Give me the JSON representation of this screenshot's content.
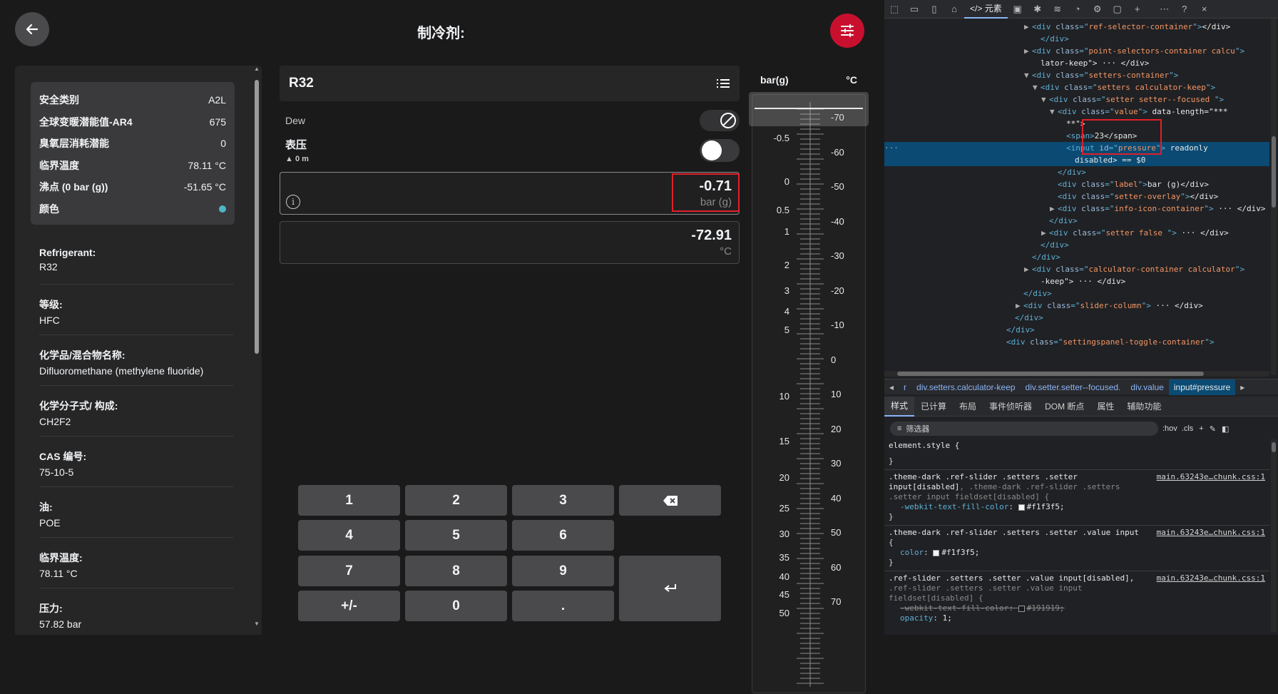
{
  "header": {
    "title": "制冷剂:"
  },
  "info_card": [
    {
      "k": "安全类别",
      "v": "A2L"
    },
    {
      "k": "全球变暖潜能值-AR4",
      "v": "675"
    },
    {
      "k": "臭氧层消耗潜能",
      "v": "0"
    },
    {
      "k": "临界温度",
      "v": "78.11 °C"
    },
    {
      "k": "沸点 (0 bar (g))",
      "v": "-51.65 °C"
    },
    {
      "k": "颜色",
      "v": ""
    }
  ],
  "properties": [
    {
      "k": "Refrigerant:",
      "v": "R32"
    },
    {
      "k": "等级:",
      "v": "HFC"
    },
    {
      "k": "化学品/混合物名称:",
      "v": "Difluoromethane (methylene fluoride)"
    },
    {
      "k": "化学分子式/ 构成:",
      "v": "CH2F2"
    },
    {
      "k": "CAS 编号:",
      "v": "75-10-5"
    },
    {
      "k": "油:",
      "v": "POE"
    },
    {
      "k": "临界温度:",
      "v": "78.11 °C"
    },
    {
      "k": "压力:",
      "v": "57.82 bar"
    }
  ],
  "ref_selector": {
    "name": "R32"
  },
  "toggles": {
    "dew_label": "Dew",
    "pressure_label": "表压",
    "altitude": "0 m"
  },
  "setters": {
    "pressure_value": "-0.71",
    "pressure_unit": "bar (g)",
    "temp_value": "-72.91",
    "temp_unit": "°C",
    "info_glyph": "i"
  },
  "keypad": [
    "1",
    "2",
    "3",
    "4",
    "5",
    "6",
    "7",
    "8",
    "9",
    "+/-",
    "0",
    "."
  ],
  "slider": {
    "left_unit": "bar(g)",
    "right_unit": "°C",
    "left_ticks": [
      "-0.5",
      "0",
      "0.5",
      "1",
      "2",
      "3",
      "4",
      "5",
      "10",
      "15",
      "20",
      "25",
      "30",
      "35",
      "40",
      "45",
      "50"
    ],
    "right_ticks": [
      "-70",
      "-60",
      "-50",
      "-40",
      "-30",
      "-20",
      "-10",
      "0",
      "10",
      "20",
      "30",
      "40",
      "50",
      "60",
      "70"
    ]
  },
  "devtools": {
    "tab_elements": "元素",
    "dom_lines": [
      {
        "i": 16,
        "p": "▶",
        "tag": "div",
        "attr": "class",
        "val": "ref-selector-container",
        "tail": "</div>"
      },
      {
        "i": 17,
        "p": "",
        "tag": "/div",
        "attr": "",
        "val": "",
        "tail": ""
      },
      {
        "i": 16,
        "p": "▶",
        "tag": "div",
        "attr": "class",
        "val": "point-selectors-container calcu",
        "tail": ""
      },
      {
        "i": 17,
        "p": "",
        "tag": "",
        "attr": "",
        "val": "",
        "tail": "lator-keep\"> ··· </div>"
      },
      {
        "i": 16,
        "p": "▼",
        "tag": "div",
        "attr": "class",
        "val": "setters-container",
        "tail": ""
      },
      {
        "i": 17,
        "p": "▼",
        "tag": "div",
        "attr": "class",
        "val": "setters calculator-keep",
        "tail": ""
      },
      {
        "i": 18,
        "p": "▼",
        "tag": "div",
        "attr": "class",
        "val": "setter setter--focused  ",
        "tail": ""
      },
      {
        "i": 19,
        "p": "▼",
        "tag": "div",
        "attr": "class",
        "val": "value",
        "tail": " data-length=\"***"
      },
      {
        "i": 20,
        "p": "",
        "tag": "",
        "attr": "",
        "val": "",
        "tail": "**\">"
      },
      {
        "i": 20,
        "p": "",
        "tag": "span",
        "attr": "",
        "val": "",
        "tail": "23</span>"
      },
      {
        "i": 20,
        "p": "",
        "tag": "input",
        "attr": "id",
        "val": "pressure",
        "tail": " readonly"
      },
      {
        "i": 21,
        "p": "",
        "tag": "",
        "attr": "",
        "val": "",
        "tail": "disabled> == $0"
      },
      {
        "i": 19,
        "p": "",
        "tag": "/div",
        "attr": "",
        "val": "",
        "tail": ""
      },
      {
        "i": 19,
        "p": "",
        "tag": "div",
        "attr": "class",
        "val": "label",
        "tail": "bar (g)</div>"
      },
      {
        "i": 19,
        "p": "",
        "tag": "div",
        "attr": "class",
        "val": "setter-overlay",
        "tail": "</div>"
      },
      {
        "i": 19,
        "p": "▶",
        "tag": "div",
        "attr": "class",
        "val": "info-icon-container",
        "tail": " ··· </div>"
      },
      {
        "i": 18,
        "p": "",
        "tag": "/div",
        "attr": "",
        "val": "",
        "tail": ""
      },
      {
        "i": 18,
        "p": "▶",
        "tag": "div",
        "attr": "class",
        "val": "setter false  ",
        "tail": " ··· </div>"
      },
      {
        "i": 17,
        "p": "",
        "tag": "/div",
        "attr": "",
        "val": "",
        "tail": ""
      },
      {
        "i": 16,
        "p": "",
        "tag": "/div",
        "attr": "",
        "val": "",
        "tail": ""
      },
      {
        "i": 16,
        "p": "▶",
        "tag": "div",
        "attr": "class",
        "val": "calculator-container calculator",
        "tail": ""
      },
      {
        "i": 17,
        "p": "",
        "tag": "",
        "attr": "",
        "val": "",
        "tail": "-keep\"> ··· </div>"
      },
      {
        "i": 15,
        "p": "",
        "tag": "/div",
        "attr": "",
        "val": "",
        "tail": ""
      },
      {
        "i": 15,
        "p": "▶",
        "tag": "div",
        "attr": "class",
        "val": "slider-column",
        "tail": " ··· </div>"
      },
      {
        "i": 14,
        "p": "",
        "tag": "/div",
        "attr": "",
        "val": "",
        "tail": ""
      },
      {
        "i": 13,
        "p": "",
        "tag": "/div",
        "attr": "",
        "val": "",
        "tail": ""
      },
      {
        "i": 13,
        "p": "",
        "tag": "div",
        "attr": "class",
        "val": "settingspanel-toggle-container",
        "tail": ""
      }
    ],
    "breadcrumb": [
      "r",
      "div.setters.calculator-keep",
      "div.setter.setter--focused.",
      "div.value",
      "input#pressure"
    ],
    "sub_tabs": [
      "样式",
      "已计算",
      "布局",
      "事件侦听器",
      "DOM 断点",
      "属性",
      "辅助功能"
    ],
    "filter_placeholder": "筛选器",
    "hov": ":hov",
    "cls": ".cls",
    "element_style": "element.style {",
    "close_brace": "}",
    "rule1_line1": ".theme-dark .ref-slider .setters .setter",
    "rule1_line2a": "input[disabled]",
    "rule1_line2b": ", .theme-dark .ref-slider .setters",
    "rule1_line3": ".setter input fieldset[disabled] {",
    "rule1_prop": "-webkit-text-fill-color",
    "rule1_val": "#f1f3f5;",
    "rule2_line1": ".theme-dark .ref-slider .setters .setter .value input",
    "rule2_line2": "{",
    "rule2_prop": "color",
    "rule2_val": "#f1f3f5;",
    "rule3_line1": ".ref-slider .setters .setter .value input[disabled],",
    "rule3_line2": ".ref-slider .setters .setter .value input",
    "rule3_line3": "fieldset[disabled] {",
    "rule3_prop1": "-webkit-text-fill-color: ",
    "rule3_val1": "#191919;",
    "rule3_prop2": "opacity",
    "rule3_val2": "1;",
    "source": "main.63243e…chunk.css:1"
  },
  "colors": {
    "accent_red": "#c8102e",
    "refrigerant_color": "#4fb6c8"
  }
}
